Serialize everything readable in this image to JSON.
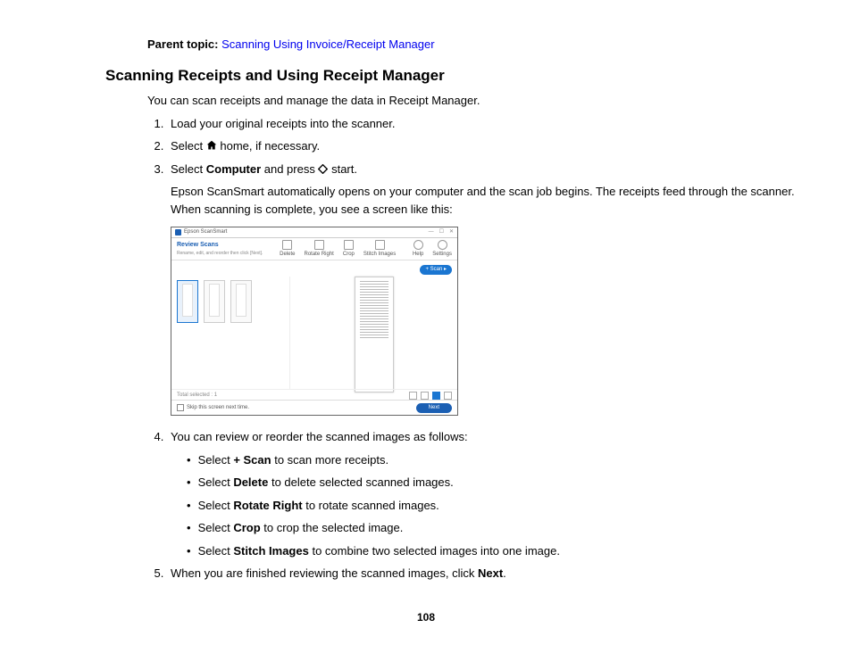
{
  "parent_topic": {
    "label": "Parent topic:",
    "link": "Scanning Using Invoice/Receipt Manager"
  },
  "heading": "Scanning Receipts and Using Receipt Manager",
  "intro": "You can scan receipts and manage the data in Receipt Manager.",
  "steps": {
    "s1": "Load your original receipts into the scanner.",
    "s2a": "Select ",
    "s2b": " home, if necessary.",
    "s3a": "Select ",
    "s3b": "Computer",
    "s3c": " and press ",
    "s3d": " start.",
    "s3_para": "Epson ScanSmart automatically opens on your computer and the scan job begins. The receipts feed through the scanner. When scanning is complete, you see a screen like this:",
    "s4": "You can review or reorder the scanned images as follows:",
    "s5a": "When you are finished reviewing the scanned images, click ",
    "s5b": "Next",
    "s5c": "."
  },
  "bullets": {
    "b1a": "Select ",
    "b1b": "+ Scan",
    "b1c": " to scan more receipts.",
    "b2a": "Select ",
    "b2b": "Delete",
    "b2c": " to delete selected scanned images.",
    "b3a": "Select ",
    "b3b": "Rotate Right",
    "b3c": " to rotate scanned images.",
    "b4a": "Select ",
    "b4b": "Crop",
    "b4c": " to crop the selected image.",
    "b5a": "Select ",
    "b5b": "Stitch Images",
    "b5c": " to combine two selected images into one image."
  },
  "figure": {
    "app_title": "Epson ScanSmart",
    "review_title": "Review Scans",
    "review_sub": "Rename, edit, and reorder then click [Next].",
    "tools": {
      "delete": "Delete",
      "rotate": "Rotate Right",
      "crop": "Crop",
      "stitch": "Stitch Images"
    },
    "right": {
      "help": "Help",
      "settings": "Settings"
    },
    "scan_btn": "+ Scan ▸",
    "total": "Total selected : 1",
    "skip": "Skip this screen next time.",
    "next": "Next"
  },
  "page_number": "108"
}
